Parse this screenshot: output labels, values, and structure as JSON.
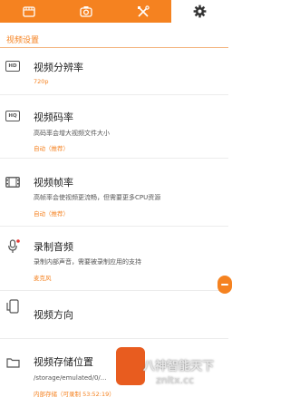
{
  "tabs": [
    {
      "icon": "video-icon"
    },
    {
      "icon": "camera-icon"
    },
    {
      "icon": "tools-icon"
    },
    {
      "icon": "settings-gear-icon",
      "active": true
    }
  ],
  "accent_color": "#f58220",
  "section": {
    "title": "视频设置"
  },
  "settings": {
    "resolution": {
      "title": "视频分辨率",
      "value": "720p",
      "icon": "hd-icon"
    },
    "bitrate": {
      "title": "视频码率",
      "desc": "高码率会增大视频文件大小",
      "value": "自动（推荐）",
      "icon": "hq-icon"
    },
    "framerate": {
      "title": "视频帧率",
      "desc": "高帧率会使视频更流畅，但需要更多CPU资源",
      "value": "自动（推荐）",
      "icon": "film-icon"
    },
    "audio": {
      "title": "录制音频",
      "desc": "录制内部声音，需要被录制应用的支持",
      "value": "麦克风",
      "icon": "microphone-icon"
    },
    "orientation": {
      "title": "视频方向",
      "icon": "phone-rotate-icon"
    },
    "storage": {
      "title": "视频存储位置",
      "path": "/storage/emulated/0/...",
      "value": "内部存储（可录制 53:52:19）",
      "icon": "folder-icon"
    }
  },
  "watermark": {
    "text": "八神智能天下",
    "sub": "znltx.cc"
  }
}
